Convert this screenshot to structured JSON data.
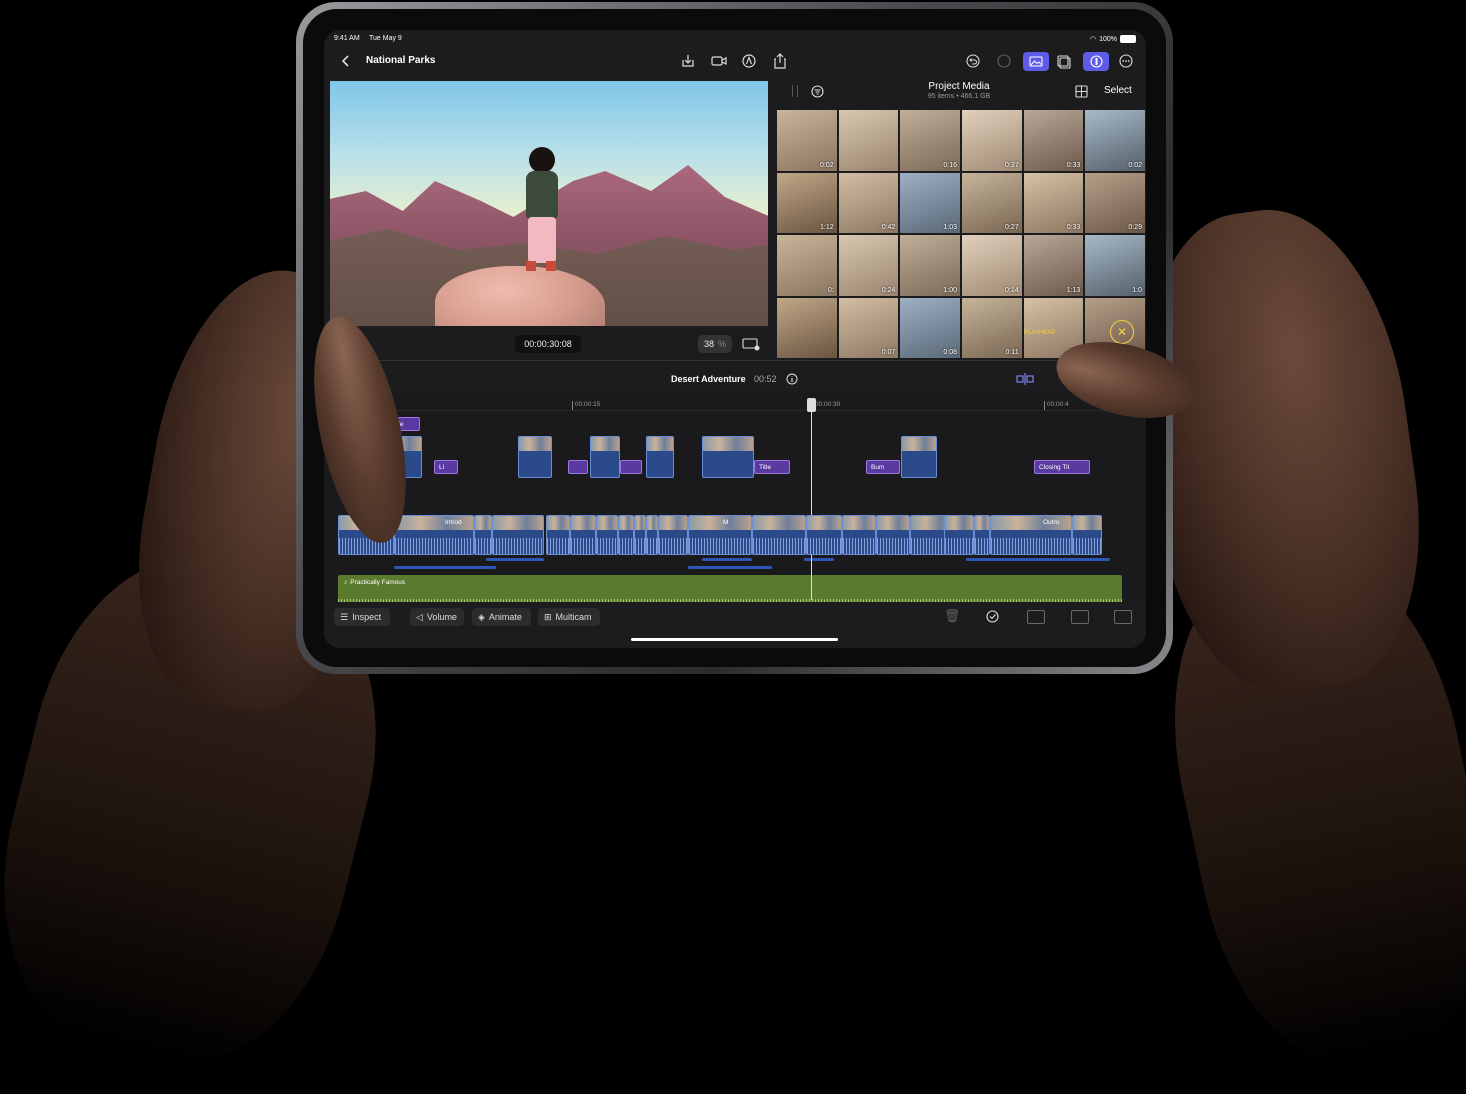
{
  "status": {
    "time": "9:41 AM",
    "date": "Tue May 9",
    "battery": "100%"
  },
  "nav": {
    "back_label": "",
    "project_title": "National Parks"
  },
  "viewer": {
    "timecode": "00:00:30:08",
    "zoom_value": "38",
    "zoom_unit": "%"
  },
  "browser": {
    "title": "Project Media",
    "subtitle": "95 items  •  466.1 GB",
    "select_label": "Select"
  },
  "media": {
    "durations": [
      "0:02",
      "",
      "0:16",
      "0:37",
      "0:33",
      "0:02",
      "1:12",
      "0:42",
      "1:03",
      "0:27",
      "0:33",
      "0:29",
      "0:",
      "0:24",
      "1:00",
      "0:14",
      "1:13",
      "1:0",
      "",
      "0:07",
      "0:08",
      "0:11",
      "0:31",
      "",
      "0:22"
    ],
    "playhead_label": "PLAYHEAD"
  },
  "timeline": {
    "project_name": "Desert Adventure",
    "duration": "00:52",
    "ticks": [
      "00:00:15",
      "00:00:30",
      "00:00:4"
    ],
    "titles": [
      "sential Title",
      "Ll",
      "Title",
      "Bum",
      "Closing Tit"
    ],
    "clip_labels": [
      "Introd",
      "M",
      "Outro"
    ],
    "music_label": "Practically Famous"
  },
  "toolbar": {
    "inspect_label": "Inspect",
    "volume_label": "Volume",
    "animate_label": "Animate",
    "multicam_label": "Multicam"
  },
  "colors": {
    "accent": "#5e5ce6",
    "clip": "#2b4a8a",
    "music": "#5a7a2e",
    "title": "#5a3aa0"
  }
}
